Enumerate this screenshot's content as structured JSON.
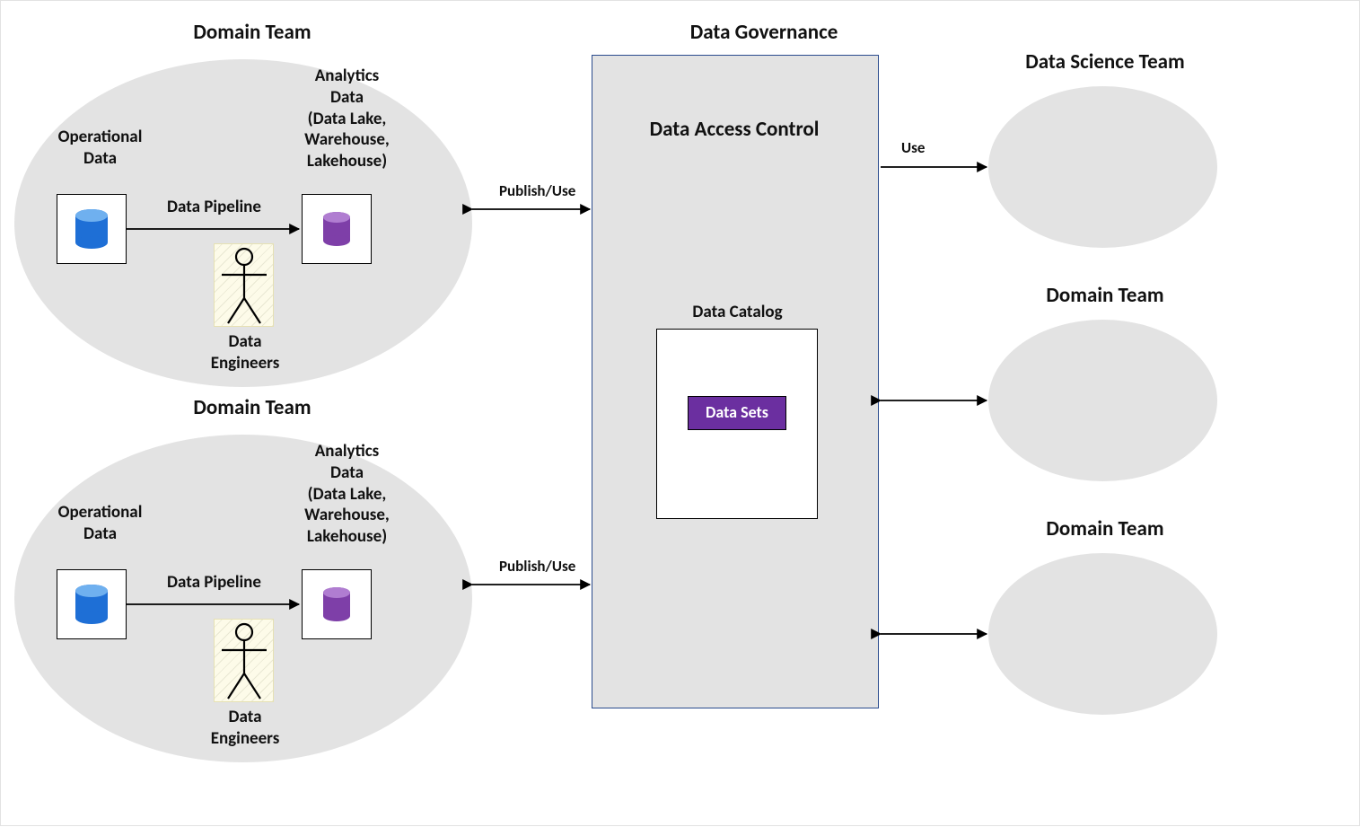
{
  "titles": {
    "domain_team_1": "Domain Team",
    "domain_team_2": "Domain Team",
    "data_governance": "Data Governance",
    "data_science_team": "Data Science Team",
    "right_domain_team_1": "Domain Team",
    "right_domain_team_2": "Domain Team"
  },
  "governance": {
    "access_control": "Data Access Control",
    "catalog": "Data Catalog",
    "data_sets": "Data Sets"
  },
  "domain": {
    "operational_data": "Operational\nData",
    "analytics_data": "Analytics\nData\n(Data Lake,\nWarehouse,\nLakehouse)",
    "pipeline": "Data Pipeline",
    "engineers": "Data\nEngineers"
  },
  "connectors": {
    "publish_use": "Publish/Use",
    "use": "Use"
  },
  "colors": {
    "blue": "#1e6fd6",
    "purple": "#7e3fa8",
    "gov_border": "#2a4b8d",
    "ellipse": "#e3e3e3"
  }
}
